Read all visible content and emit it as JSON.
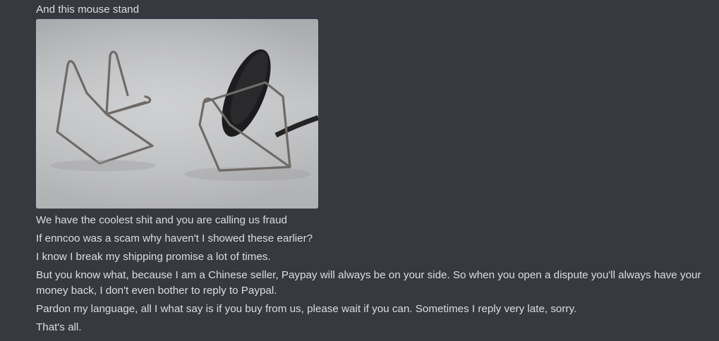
{
  "messages": {
    "intro": "And this mouse stand",
    "attachment": {
      "kind": "image",
      "description_icon": "photo-attachment"
    },
    "lines": [
      "We have the coolest shit and you are calling us fraud",
      "If enncoo was a scam why haven't I showed these earlier?",
      "I know I break my shipping promise a lot of times.",
      "But you know what, because I am a Chinese seller, Paypay will always be on your side. So when you open a dispute you'll always have your money back, I don't even bother to reply to Paypal.",
      "Pardon my language, all I what say is if you buy from us, please wait if you can. Sometimes I reply very late, sorry.",
      "That's all."
    ]
  },
  "colors": {
    "background": "#36393f",
    "text": "#dcddde"
  }
}
